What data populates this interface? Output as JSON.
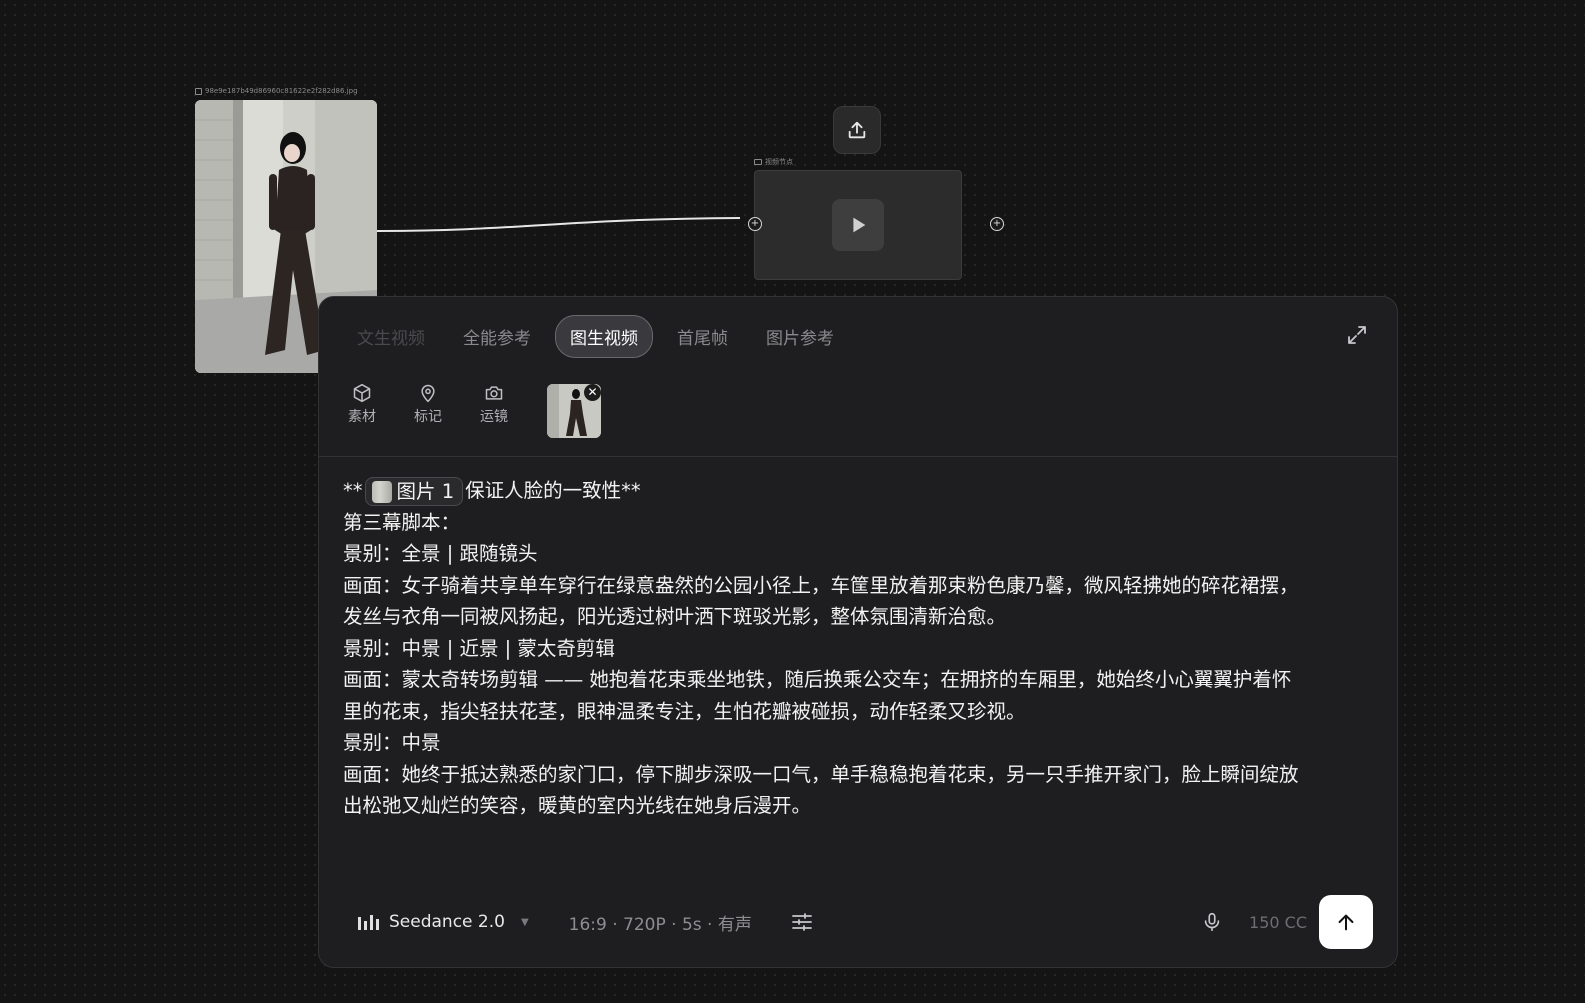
{
  "image_node": {
    "filename": "98e9e187b49d86960c81622e2f282d86.jpg"
  },
  "video_node": {
    "label": "视频节点"
  },
  "panel": {
    "tabs": [
      {
        "label": "文生视频",
        "state": "disabled"
      },
      {
        "label": "全能参考",
        "state": "normal"
      },
      {
        "label": "图生视频",
        "state": "active"
      },
      {
        "label": "首尾帧",
        "state": "normal"
      },
      {
        "label": "图片参考",
        "state": "normal"
      }
    ],
    "tools": [
      {
        "label": "素材",
        "icon": "cube-icon"
      },
      {
        "label": "标记",
        "icon": "pin-icon"
      },
      {
        "label": "运镜",
        "icon": "camera-icon"
      }
    ],
    "thumb_close": "✕",
    "editor": {
      "prefix": "**",
      "chip_label": "图片 1",
      "line1_suffix": "保证人脸的一致性**",
      "lines": [
        "第三幕脚本：",
        "景别：全景 | 跟随镜头",
        "画面：女子骑着共享单车穿行在绿意盎然的公园小径上，车筐里放着那束粉色康乃馨，微风轻拂她的碎花裙摆，",
        "发丝与衣角一同被风扬起，阳光透过树叶洒下斑驳光影，整体氛围清新治愈。",
        "景别：中景 | 近景 | 蒙太奇剪辑",
        "画面：蒙太奇转场剪辑 —— 她抱着花束乘坐地铁，随后换乘公交车；在拥挤的车厢里，她始终小心翼翼护着怀",
        "里的花束，指尖轻扶花茎，眼神温柔专注，生怕花瓣被碰损，动作轻柔又珍视。",
        "景别：中景",
        "画面：她终于抵达熟悉的家门口，停下脚步深吸一口气，单手稳稳抱着花束，另一只手推开家门，脸上瞬间绽放",
        "出松弛又灿烂的笑容，暖黄的室内光线在她身后漫开。"
      ]
    },
    "bottom": {
      "model_name": "Seedance 2.0",
      "params": "16:9 · 720P · 5s · 有声",
      "credits": "150 CC"
    }
  },
  "colors": {
    "background": "#141414",
    "panel": "#1e1e20",
    "active_tab_bg": "#3a3a3e",
    "send_button": "#ffffff"
  }
}
